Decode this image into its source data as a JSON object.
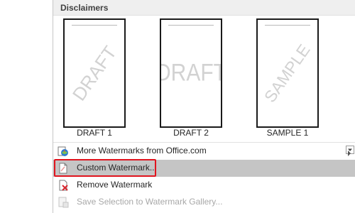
{
  "section": {
    "title": "Disclaimers"
  },
  "gallery": {
    "items": [
      {
        "label": "DRAFT 1",
        "watermark": "DRAFT",
        "style": "diagonal"
      },
      {
        "label": "DRAFT 2",
        "watermark": "DRAFT",
        "style": "horizontal"
      },
      {
        "label": "SAMPLE 1",
        "watermark": "SAMPLE",
        "style": "diagonal"
      }
    ]
  },
  "menu": {
    "more": {
      "label": "More Watermarks from Office.com",
      "icon": "office-globe-icon",
      "has_submenu": true
    },
    "custom": {
      "label": "Custom Watermark...",
      "icon": "document-page-icon",
      "highlighted": true
    },
    "remove": {
      "label": "Remove Watermark",
      "icon": "remove-watermark-icon"
    },
    "save": {
      "label": "Save Selection to Watermark Gallery...",
      "icon": "save-gallery-icon",
      "disabled": true
    }
  },
  "colors": {
    "highlight_border": "#e0141e",
    "hover_background": "#c5c5c5",
    "watermark_text": "#d2d2d2",
    "disabled_text": "#a8a8a8"
  }
}
